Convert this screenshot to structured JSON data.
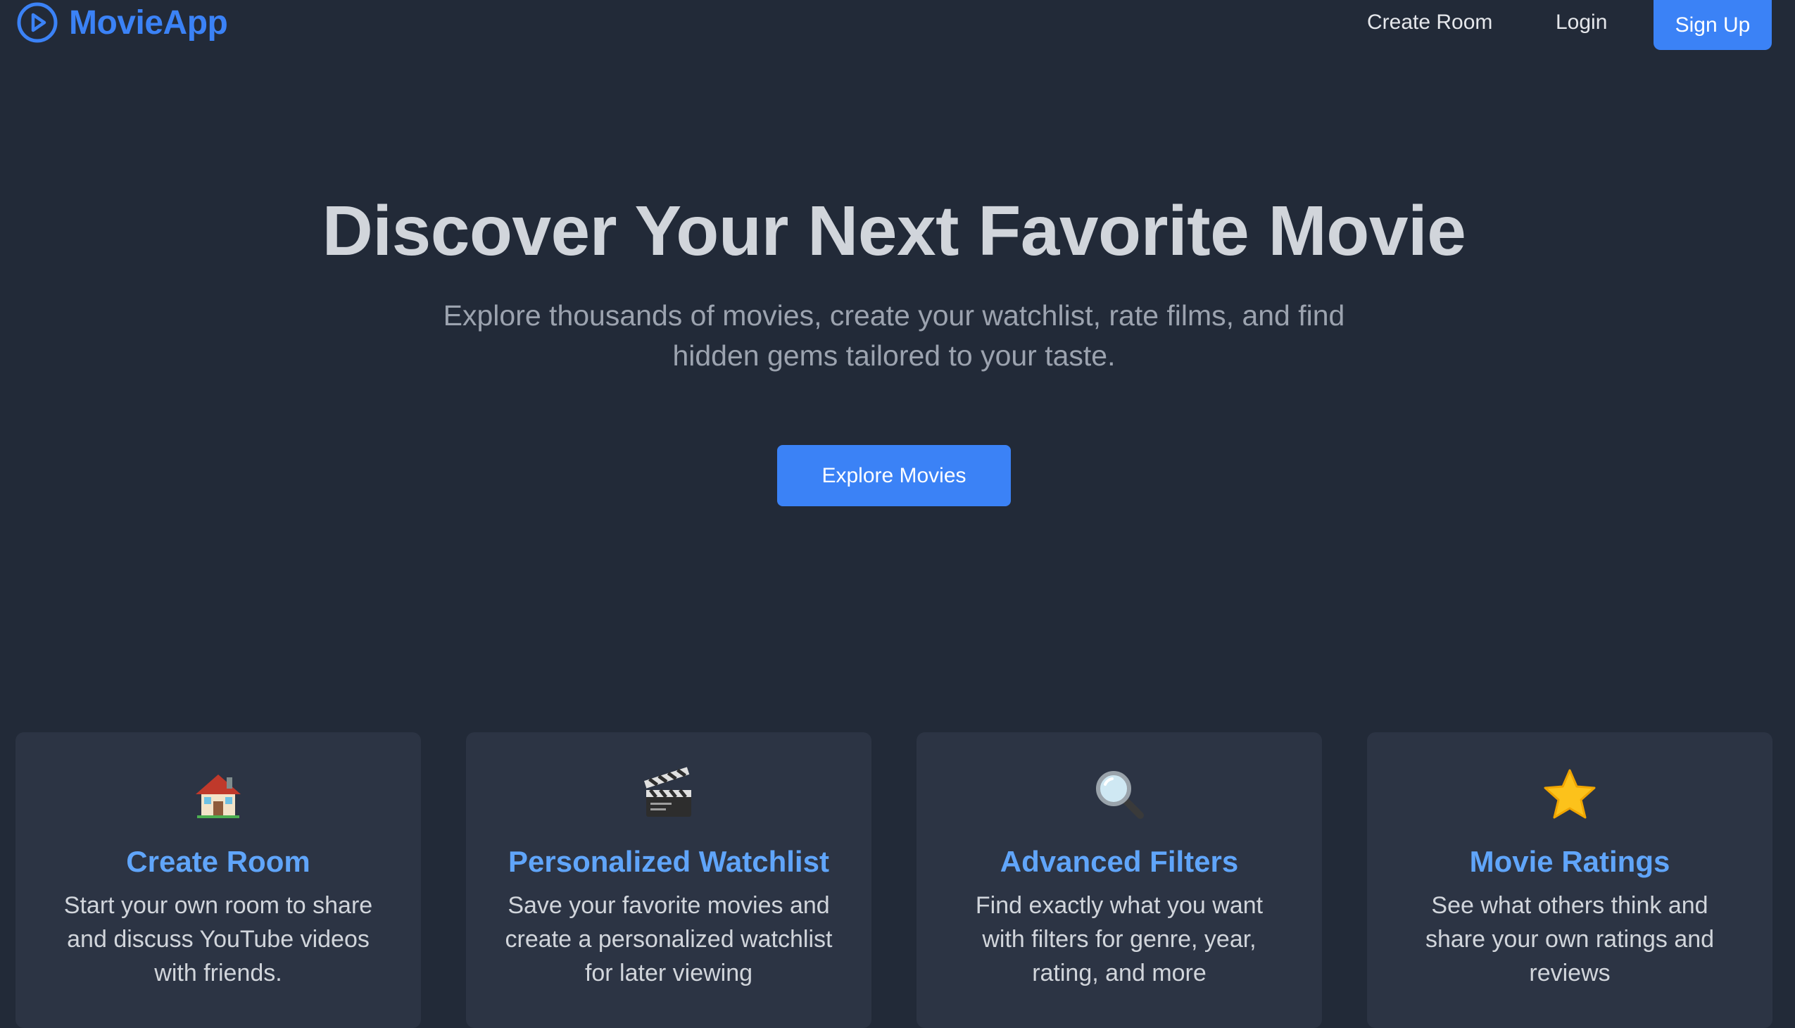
{
  "nav": {
    "brand": "MovieApp",
    "brand_icon": "play-circle-icon",
    "create_room": "Create Room",
    "login": "Login",
    "signup": "Sign Up"
  },
  "hero": {
    "title": "Discover Your Next Favorite Movie",
    "subtitle": "Explore thousands of movies, create your watchlist, rate films, and find hidden gems tailored to your taste.",
    "cta": "Explore Movies"
  },
  "features": [
    {
      "icon": "house-icon",
      "title": "Create Room",
      "description": "Start your own room to share and discuss YouTube videos with friends."
    },
    {
      "icon": "clapperboard-icon",
      "title": "Personalized Watchlist",
      "description": "Save your favorite movies and create a personalized watchlist for later viewing"
    },
    {
      "icon": "magnifying-glass-icon",
      "title": "Advanced Filters",
      "description": "Find exactly what you want with filters for genre, year, rating, and more"
    },
    {
      "icon": "star-icon",
      "title": "Movie Ratings",
      "description": "See what others think and share your own ratings and reviews"
    }
  ],
  "colors": {
    "background": "#222a38",
    "card": "#2c3444",
    "accent": "#3b82f6",
    "card_title": "#60a5fa"
  }
}
